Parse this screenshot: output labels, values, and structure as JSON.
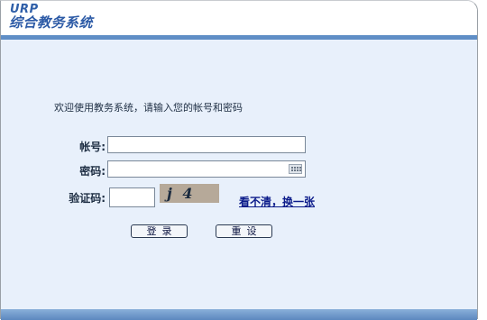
{
  "header": {
    "logo_top": "URP",
    "logo_title": "综合教务系统"
  },
  "welcome_text": "欢迎使用教务系统，请输入您的帐号和密码",
  "form": {
    "account_label": "帐号:",
    "password_label": "密码:",
    "captcha_label": "验证码:",
    "captcha_image_text": "j 4 nr",
    "refresh_link": "看不清，换一张"
  },
  "buttons": {
    "login": "登录",
    "reset": "重设"
  },
  "colors": {
    "content_background": "#e8f0fb",
    "bar_blue": "#5f8ec6",
    "link": "#0b1b8a"
  },
  "icons": [
    "virtual-keyboard-icon"
  ]
}
